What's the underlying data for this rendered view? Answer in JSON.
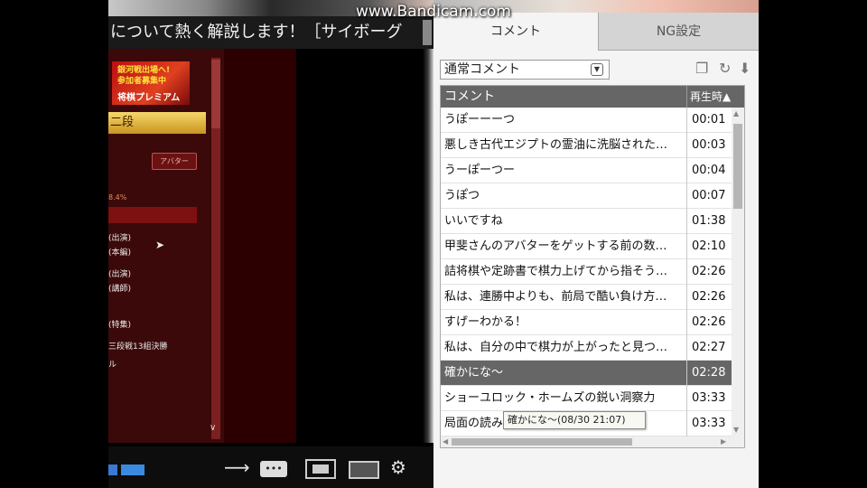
{
  "watermark": "www.Bandicam.com",
  "video": {
    "title": "について熱く解説します！［サイボーグ",
    "page": {
      "banner": [
        "銀河戦出場へ!",
        "参加者募集中",
        "将棋プレミアム"
      ],
      "dan_label": "二段",
      "avatar_button": "アバター",
      "percent_text": "8.4%",
      "links": [
        "(出演)",
        "(本編)",
        "(出演)",
        "(講師)",
        "(特集)",
        "三段戦13組決勝",
        "ル"
      ]
    }
  },
  "panel": {
    "tabs": [
      "コメント",
      "NG設定"
    ],
    "comment_type": "通常コメント",
    "headers": {
      "comment": "コメント",
      "time": "再生時▲"
    },
    "comments": [
      {
        "text": "うぽーーーつ",
        "time": "00:01"
      },
      {
        "text": "悪しき古代エジプトの霊油に洗脳された…",
        "time": "00:03"
      },
      {
        "text": "うーぽーつー",
        "time": "00:04"
      },
      {
        "text": "うぽつ",
        "time": "00:07"
      },
      {
        "text": "いいですね",
        "time": "01:38"
      },
      {
        "text": "甲斐さんのアバターをゲットする前の数…",
        "time": "02:10"
      },
      {
        "text": "詰将棋や定跡書で棋力上げてから指そう…",
        "time": "02:26"
      },
      {
        "text": "私は、連勝中よりも、前局で酷い負け方…",
        "time": "02:26"
      },
      {
        "text": "すげーわかる！",
        "time": "02:26"
      },
      {
        "text": "私は、自分の中で棋力が上がったと見つ…",
        "time": "02:27"
      },
      {
        "text": "確かにな〜",
        "time": "02:28"
      },
      {
        "text": "ショーユロック・ホームズの鋭い洞察力",
        "time": "03:33"
      },
      {
        "text": "局面の読み解き、面白いね！",
        "time": "03:33"
      }
    ],
    "selected_index": 10,
    "tooltip": "確かにな〜(08/30 21:07)"
  },
  "icons": {
    "arrow": "arrow-right-icon",
    "comment_toggle": "comment-toggle-icon",
    "screen_a": "screen-size-icon",
    "screen_b": "fullscreen-icon",
    "gear": "gear-icon",
    "copy": "copy-icon",
    "reload": "reload-icon",
    "download": "download-icon"
  },
  "colors": {
    "panel_bg": "#f4f4f4",
    "header_bg": "#666666",
    "selected_row": "#666666",
    "dan_bar": "#e0b040",
    "page_bg": "#3b0909"
  }
}
